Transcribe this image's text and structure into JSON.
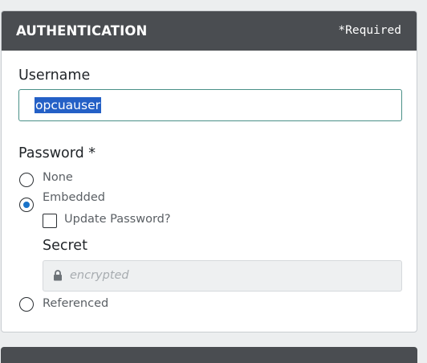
{
  "section": {
    "title": "AUTHENTICATION",
    "required_note": "*Required"
  },
  "username": {
    "label": "Username",
    "value": "opcuauser"
  },
  "password": {
    "label": "Password *",
    "options": [
      {
        "label": "None",
        "selected": false
      },
      {
        "label": "Embedded",
        "selected": true
      },
      {
        "label": "Referenced",
        "selected": false
      }
    ],
    "update_password": {
      "label": "Update Password?",
      "checked": false
    },
    "secret": {
      "label": "Secret",
      "placeholder": "encrypted",
      "icon": "lock-icon"
    }
  },
  "colors": {
    "header_bg": "#4a4d51",
    "radio_accent": "#1a73c9",
    "input_focus_border": "#4a9188",
    "selection_bg": "#2460c6"
  }
}
